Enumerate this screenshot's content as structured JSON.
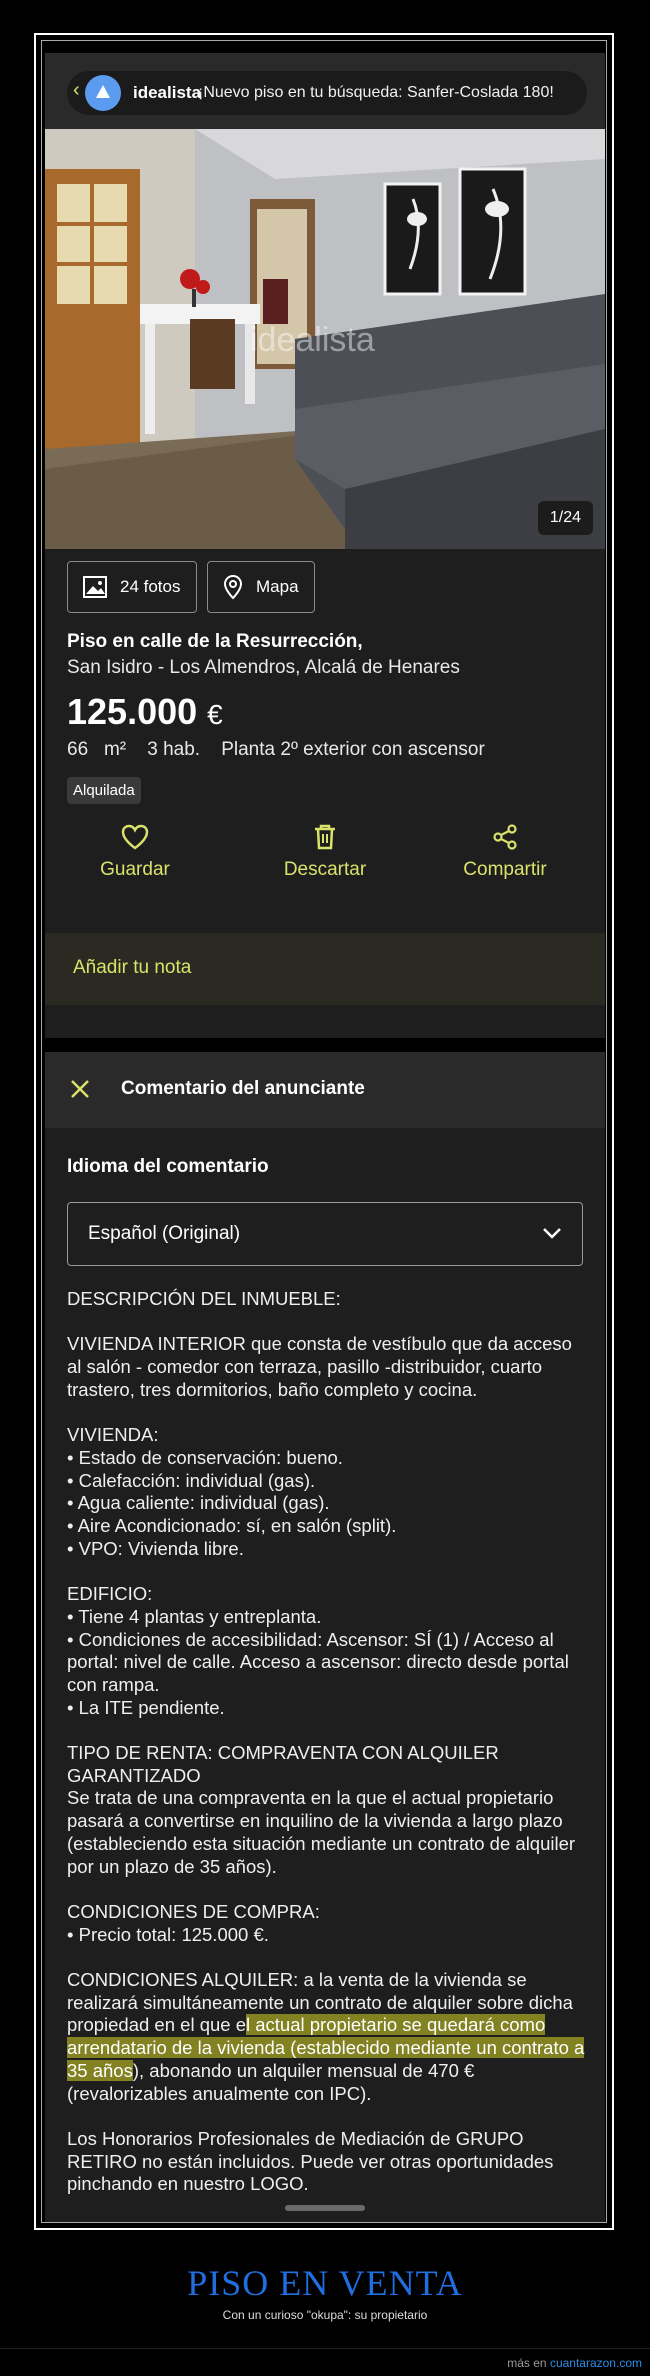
{
  "notification": {
    "brand": "idealista",
    "text": "¡Nuevo piso en tu búsqueda: Sanfer-Coslada 180!"
  },
  "gallery": {
    "counter": "1/24",
    "watermark": "idealista"
  },
  "buttons": {
    "photos": "24 fotos",
    "map": "Mapa"
  },
  "listing": {
    "title": "Piso en calle de la Resurrección,",
    "address": "San Isidro - Los Almendros, Alcalá de Henares",
    "price": "125.000",
    "currency": "€",
    "area_value": "66",
    "area_unit": "m²",
    "rooms": "3 hab.",
    "floor": "Planta 2º exterior con ascensor",
    "tag": "Alquilada"
  },
  "actions": {
    "save": "Guardar",
    "discard": "Descartar",
    "share": "Compartir"
  },
  "note": {
    "label": "Añadir tu nota"
  },
  "comment": {
    "header": "Comentario del anunciante",
    "language_label": "Idioma del comentario",
    "language_value": "Español (Original)",
    "lines": {
      "l1": "DESCRIPCIÓN DEL INMUEBLE:",
      "l2": "VIVIENDA INTERIOR que consta de vestíbulo que da acceso al salón - comedor con terraza, pasillo -distribuidor, cuarto trastero, tres dormitorios, baño completo y cocina.",
      "l3": "VIVIENDA:",
      "l4": "• Estado de conservación: bueno.",
      "l5": "• Calefacción: individual (gas).",
      "l6": "• Agua caliente: individual (gas).",
      "l7": "• Aire Acondicionado: sí, en salón (split).",
      "l8": "• VPO: Vivienda libre.",
      "l9": "EDIFICIO:",
      "l10": "• Tiene 4 plantas y entreplanta.",
      "l11": "• Condiciones de accesibilidad: Ascensor: SÍ (1) / Acceso al portal: nivel de calle. Acceso a ascensor: directo desde portal con rampa.",
      "l12": "• La ITE pendiente.",
      "l13": "TIPO DE RENTA: COMPRAVENTA CON ALQUILER GARANTIZADO",
      "l14": "Se trata de una compraventa en la que el actual propietario pasará a convertirse en inquilino de la vivienda a largo plazo (estableciendo esta situación mediante un contrato de alquiler por un plazo de 35 años).",
      "l15": "CONDICIONES DE COMPRA:",
      "l16": "• Precio total: 125.000 €.",
      "l17a": "CONDICIONES ALQUILER: a la venta de la vivienda se realizará simultáneamente un contrato de alquiler sobre dicha propiedad en el que e",
      "l17b": "l actual propietario se quedará como arrendatario de la vivienda (establecido mediante un contrato a 35 años",
      "l17c": "), abonando un alquiler mensual de 470 € (revalorizables anualmente con IPC).",
      "l18": "Los Honorarios Profesionales de Mediación de GRUPO RETIRO no están incluidos. Puede ver otras oportunidades pinchando en nuestro LOGO."
    }
  },
  "caption": {
    "title": "PISO EN VENTA",
    "subtitle": "Con un curioso \"okupa\": su propietario"
  },
  "footer": {
    "prefix": "más en",
    "link": "cuantarazon.com"
  },
  "colors": {
    "accent": "#d9e26a",
    "card": "#1e1e1e",
    "caption": "#1f6fe0"
  }
}
